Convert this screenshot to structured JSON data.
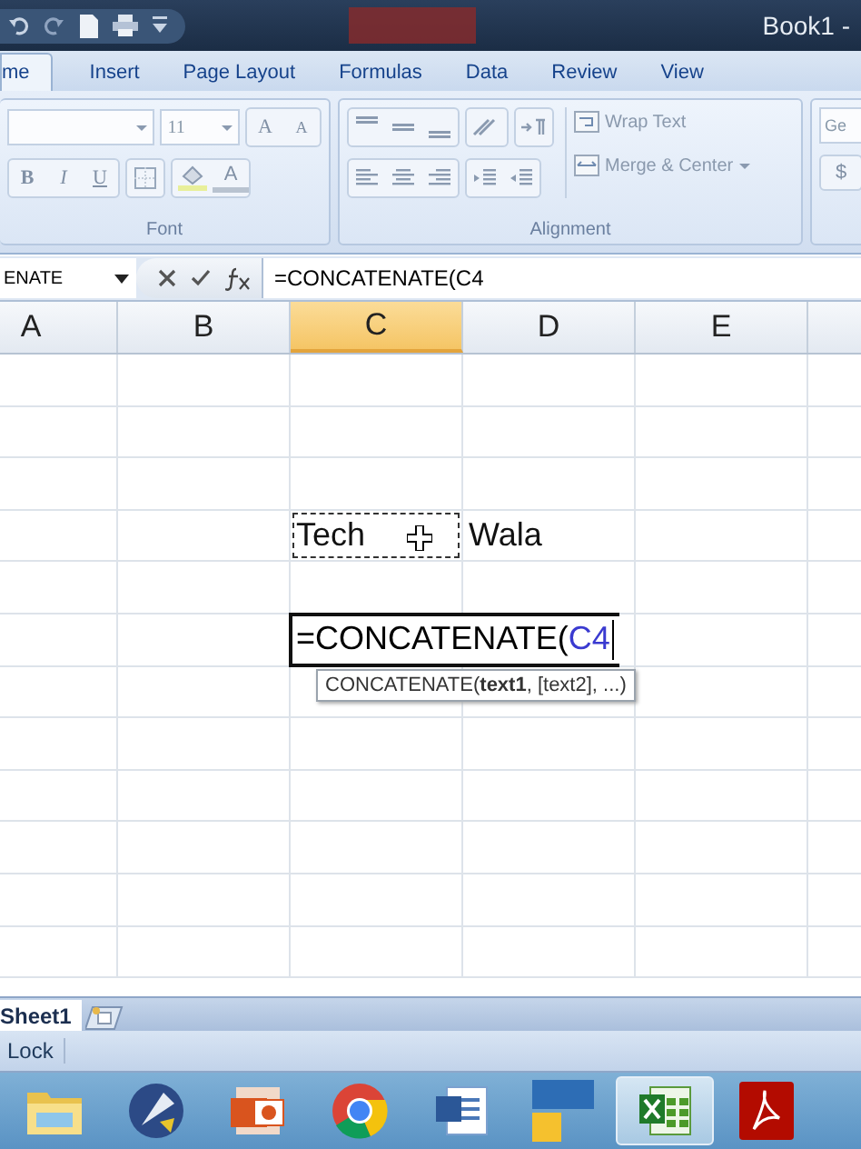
{
  "title_bar": {
    "title": "Book1 -"
  },
  "ribbon_tabs": [
    {
      "label": "me",
      "selected": true
    },
    {
      "label": "Insert",
      "selected": false
    },
    {
      "label": "Page Layout",
      "selected": false
    },
    {
      "label": "Formulas",
      "selected": false
    },
    {
      "label": "Data",
      "selected": false
    },
    {
      "label": "Review",
      "selected": false
    },
    {
      "label": "View",
      "selected": false
    }
  ],
  "font_group": {
    "label": "Font",
    "font_size": "11",
    "grow_label": "A",
    "shrink_label": "A",
    "bold": "B",
    "italic": "I",
    "underline": "U",
    "font_color_label": "A"
  },
  "alignment_group": {
    "label": "Alignment",
    "wrap_text": "Wrap Text",
    "merge_center": "Merge & Center"
  },
  "number_group": {
    "format": "Ge",
    "currency": "$"
  },
  "formula_bar": {
    "name_box": "ENATE",
    "formula": "=CONCATENATE(C4"
  },
  "sheet": {
    "columns": [
      {
        "label": "A",
        "selected": false
      },
      {
        "label": "B",
        "selected": false
      },
      {
        "label": "C",
        "selected": true
      },
      {
        "label": "D",
        "selected": false
      },
      {
        "label": "E",
        "selected": false
      }
    ],
    "rows": [
      {},
      {},
      {},
      {
        "cells": [
          null,
          null,
          {
            "kind": "text",
            "text": "Tech",
            "copy_marquee": true
          },
          {
            "kind": "text",
            "text": "Wala",
            "copy_marquee": false
          }
        ]
      },
      {},
      {
        "cells": [
          null,
          null,
          {
            "kind": "editor",
            "formula": "=CONCATENATE(",
            "reference": "C4",
            "tooltip": "CONCATENATE(**text1**, [text2], ...)"
          }
        ]
      },
      {},
      {},
      {},
      {},
      {},
      {}
    ]
  },
  "sheet_tabs": [
    {
      "label": "Sheet1",
      "selected": true
    }
  ],
  "status_bar": {
    "text": "Lock"
  },
  "taskbar": [
    {
      "kind": "folder",
      "selected": false
    },
    {
      "kind": "compass",
      "selected": false
    },
    {
      "kind": "slides",
      "selected": false
    },
    {
      "kind": "browser",
      "selected": false
    },
    {
      "kind": "document",
      "selected": false
    },
    {
      "kind": "tiles",
      "selected": false
    },
    {
      "kind": "spreadsheet",
      "selected": true
    },
    {
      "kind": "pdf",
      "selected": false
    }
  ]
}
